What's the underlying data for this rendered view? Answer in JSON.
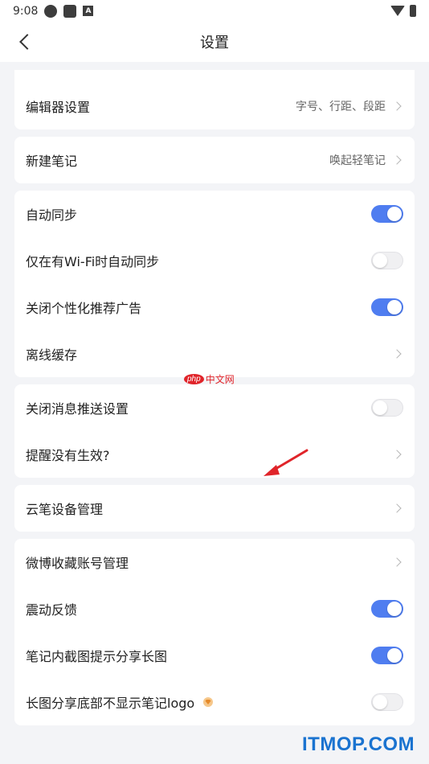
{
  "status_bar": {
    "time": "9:08"
  },
  "nav": {
    "title": "设置"
  },
  "groups": [
    {
      "rows": [
        {
          "label": "编辑器设置",
          "value": "字号、行距、段距",
          "control": "chevron"
        }
      ]
    },
    {
      "rows": [
        {
          "label": "新建笔记",
          "value": "唤起轻笔记",
          "control": "chevron"
        }
      ]
    },
    {
      "rows": [
        {
          "label": "自动同步",
          "control": "toggle",
          "state": "on"
        },
        {
          "label": "仅在有Wi-Fi时自动同步",
          "control": "toggle",
          "state": "off"
        },
        {
          "label": "关闭个性化推荐广告",
          "control": "toggle",
          "state": "on"
        },
        {
          "label": "离线缓存",
          "control": "chevron"
        }
      ]
    },
    {
      "rows": [
        {
          "label": "关闭消息推送设置",
          "control": "toggle",
          "state": "off"
        },
        {
          "label": "提醒没有生效?",
          "control": "chevron"
        }
      ]
    },
    {
      "rows": [
        {
          "label": "云笔设备管理",
          "control": "chevron"
        }
      ]
    },
    {
      "rows": [
        {
          "label": "微博收藏账号管理",
          "control": "chevron"
        },
        {
          "label": "震动反馈",
          "control": "toggle",
          "state": "on"
        },
        {
          "label": "笔记内截图提示分享长图",
          "control": "toggle",
          "state": "on"
        },
        {
          "label": "长图分享底部不显示笔记logo",
          "control": "toggle",
          "state": "off",
          "vip_icon": "vip-diamond-icon"
        }
      ]
    }
  ],
  "watermarks": {
    "php_badge": "php",
    "php_text": "中文网",
    "site": "ITMOP.COM"
  },
  "colors": {
    "accent": "#4f7df0",
    "background": "#f3f4f7",
    "annotation_arrow": "#e0242a",
    "site_watermark": "#1a73d0"
  }
}
